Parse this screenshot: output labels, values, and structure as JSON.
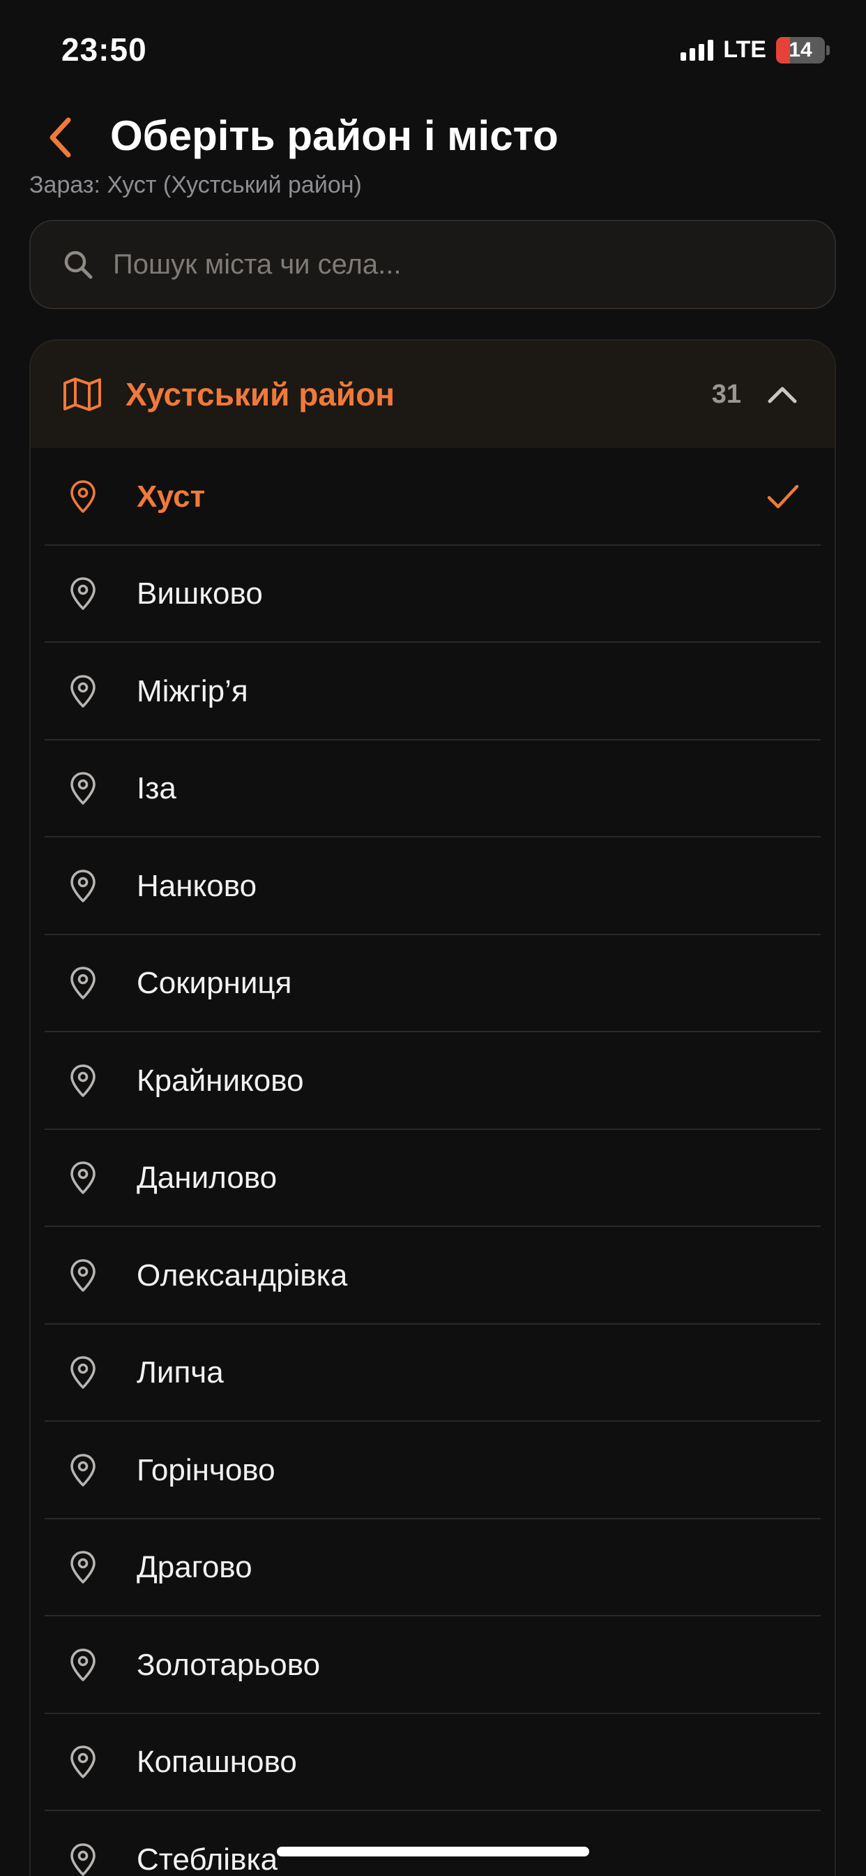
{
  "status_bar": {
    "time": "23:50",
    "network": "LTE",
    "battery": "14",
    "battery_level": 0.14
  },
  "header": {
    "title": "Оберіть район і місто",
    "current": "Зараз: Хуст (Хустський район)"
  },
  "search": {
    "placeholder": "Пошук міста чи села..."
  },
  "district": {
    "name": "Хустський район",
    "count": "31",
    "expanded": true
  },
  "cities": [
    {
      "label": "Хуст",
      "selected": true
    },
    {
      "label": "Вишково"
    },
    {
      "label": "Міжгір’я"
    },
    {
      "label": "Іза"
    },
    {
      "label": "Нанково"
    },
    {
      "label": "Сокирниця"
    },
    {
      "label": "Крайниково"
    },
    {
      "label": "Данилово"
    },
    {
      "label": "Олександрівка"
    },
    {
      "label": "Липча"
    },
    {
      "label": "Горінчово"
    },
    {
      "label": "Драгово"
    },
    {
      "label": "Золотарьово"
    },
    {
      "label": "Копашново"
    },
    {
      "label": "Стеблівка"
    }
  ],
  "colors": {
    "accent": "#f07a3a",
    "background": "#0f0f10",
    "district_header_bg": "#1c1814",
    "battery_low": "#e5423a"
  },
  "icons": {
    "back": "chevron-left-icon",
    "search": "search-icon",
    "district": "map-icon",
    "collapse": "chevron-up-icon",
    "city": "map-pin-icon",
    "selected": "checkmark-icon"
  }
}
